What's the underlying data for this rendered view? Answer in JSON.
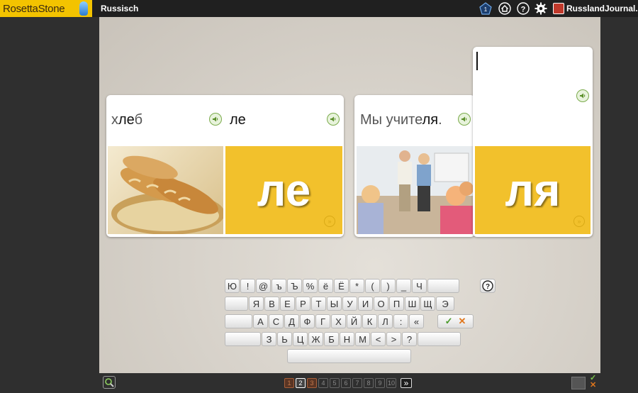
{
  "app": {
    "logo_text": "RosettaStone",
    "language": "Russisch",
    "brand": "RusslandJournal.de"
  },
  "header_icons": [
    "level-badge-icon",
    "home-icon",
    "help-icon",
    "gear-icon"
  ],
  "cards": [
    {
      "word_pre": "х",
      "word_highlight": "ле",
      "word_post": "б",
      "syllable": "ле",
      "big": "ле"
    },
    {
      "word_pre": "Мы учите",
      "word_highlight": "ля",
      "word_post": ".",
      "syllable": "",
      "big": "ля"
    }
  ],
  "keyboard": {
    "rows": [
      [
        "Ю",
        "!",
        "@",
        "ъ",
        "Ъ",
        "%",
        "ё",
        "Ё",
        "*",
        "(",
        ")",
        "_",
        "Ч",
        ""
      ],
      [
        "",
        "Я",
        "В",
        "Е",
        "Р",
        "Т",
        "Ы",
        "У",
        "И",
        "О",
        "П",
        "Ш",
        "Щ",
        "Э"
      ],
      [
        "",
        "А",
        "С",
        "Д",
        "Ф",
        "Г",
        "Х",
        "Й",
        "К",
        "Л",
        ":",
        "«"
      ],
      [
        "",
        "З",
        "Ь",
        "Ц",
        "Ж",
        "Б",
        "Н",
        "М",
        "<",
        ">",
        "?",
        ""
      ]
    ],
    "help": "?",
    "check": "✓",
    "cross": "✕"
  },
  "pagination": {
    "pages": [
      "1",
      "2",
      "3",
      "4",
      "5",
      "6",
      "7",
      "8",
      "9",
      "10"
    ],
    "current": "2",
    "next": "»"
  },
  "colors": {
    "accent": "#f2c12c",
    "bar": "#202020",
    "stage": "#d8d3cb"
  }
}
